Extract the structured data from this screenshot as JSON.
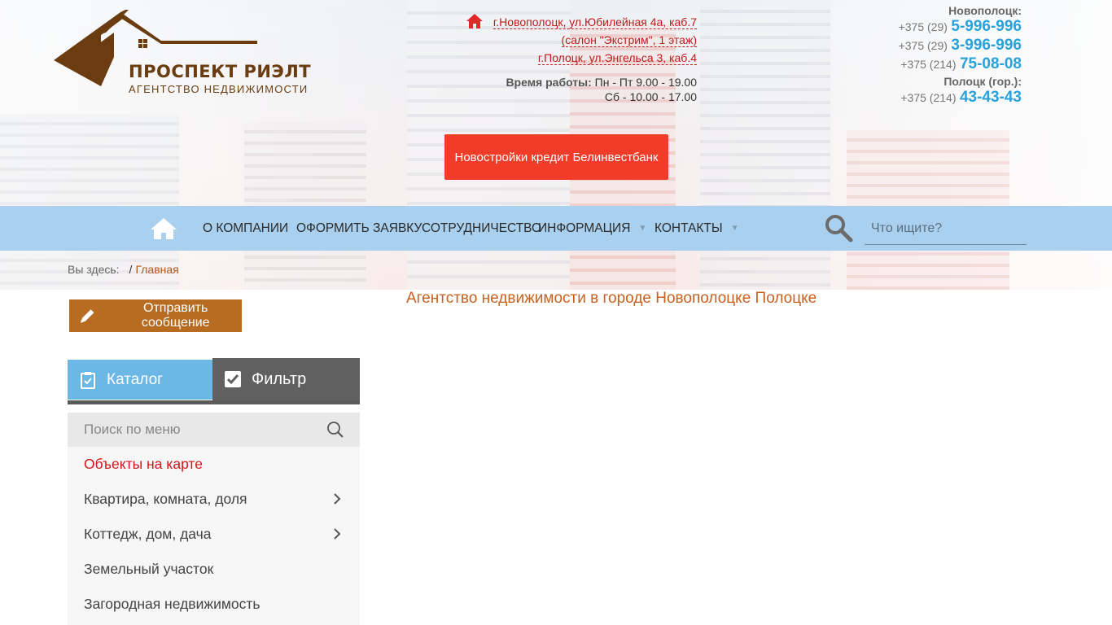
{
  "logo": {
    "name": "ПРОСПЕКТ РИЭЛТ",
    "subtitle": "АГЕНТСТВО НЕДВИЖИМОСТИ"
  },
  "address": {
    "line1": "г.Новополоцк, ул.Юбилейная 4а, каб.7",
    "line2": "(салон \"Экстрим\", 1 этаж)",
    "line3": "г.Полоцк, ул.Энгельса 3, каб.4",
    "hours_label": "Время работы:",
    "hours_weekdays": "Пн - Пт 9.00 - 19.00",
    "hours_saturday": "Сб - 10.00 - 17.00"
  },
  "phones": {
    "city1": "Новополоцк:",
    "p1_code": "+375 (29)",
    "p1_num": "5-996-996",
    "p2_code": "+375 (29)",
    "p2_num": "3-996-996",
    "p3_code": "+375 (214)",
    "p3_num": "75-08-08",
    "city2": "Полоцк (гор.):",
    "p4_code": "+375 (214)",
    "p4_num": "43-43-43"
  },
  "promo": {
    "label": "Новостройки кредит Белинвестбанк"
  },
  "nav": {
    "items": [
      {
        "label": "О компании"
      },
      {
        "label": "Оформить заявку"
      },
      {
        "label": "Сотрудничество"
      },
      {
        "label": "Информация"
      },
      {
        "label": "Контакты"
      }
    ],
    "search_placeholder": "Что ищите?"
  },
  "breadcrumb": {
    "prefix": "Вы здесь:",
    "current": "Главная"
  },
  "sidebar": {
    "send_label": "Отправить сообщение",
    "tab_catalog": "Каталог",
    "tab_filter": "Фильтр",
    "menu_search_placeholder": "Поиск по меню",
    "menu": [
      {
        "label": "Объекты на карте"
      },
      {
        "label": "Квартира, комната, доля"
      },
      {
        "label": "Коттедж, дом, дача"
      },
      {
        "label": "Земельный участок"
      },
      {
        "label": "Загородная недвижимость"
      }
    ]
  },
  "main": {
    "title": "Агентство недвижимости в городе Новополоцке Полоцке"
  },
  "colors": {
    "nav_bg": "#a9d0ee",
    "promo_bg": "#f03c28",
    "accent_brown": "#b76c21",
    "phone_blue": "#29a1db",
    "tab_active": "#6bb7e6",
    "tab_inactive": "#606060"
  }
}
